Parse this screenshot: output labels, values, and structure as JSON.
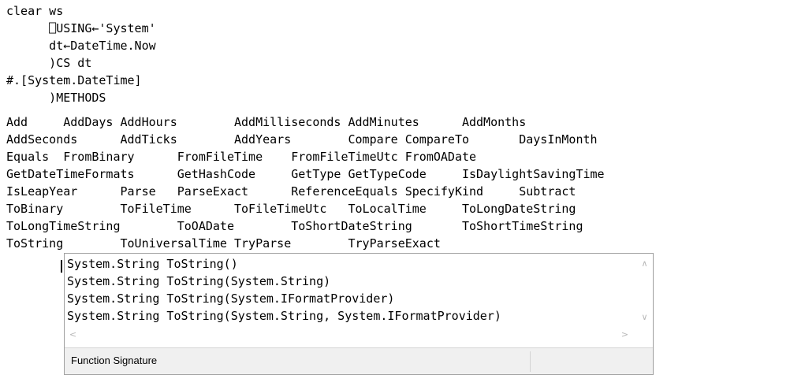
{
  "session": {
    "lines": [
      "clear ws",
      "      ⎕USING←'System'",
      "      dt←DateTime.Now",
      "      )CS dt",
      "#.[System.DateTime]",
      "      )METHODS",
      "Add     AddDays AddHours        AddMilliseconds AddMinutes      AddMonths",
      "AddSeconds      AddTicks        AddYears        Compare CompareTo       DaysInMonth",
      "Equals  FromBinary      FromFileTime    FromFileTimeUtc FromOADate",
      "GetDateTimeFormats      GetHashCode     GetType GetTypeCode     IsDaylightSavingTime",
      "IsLeapYear      Parse   ParseExact      ReferenceEquals SpecifyKind     Subtract",
      "ToBinary        ToFileTime      ToFileTimeUtc   ToLocalTime     ToLongDateString",
      "ToLongTimeString        ToOADate        ToShortDateString       ToShortTimeString",
      "ToString        ToUniversalTime TryParse        TryParseExact"
    ]
  },
  "popup": {
    "signatures": [
      "System.String ToString()",
      "System.String ToString(System.String)",
      "System.String ToString(System.IFormatProvider)",
      "System.String ToString(System.String, System.IFormatProvider)"
    ],
    "status_label": "Function Signature",
    "scroll_up_icon": "∧",
    "scroll_down_icon": "∨",
    "scroll_left_icon": "<",
    "scroll_right_icon": ">"
  }
}
